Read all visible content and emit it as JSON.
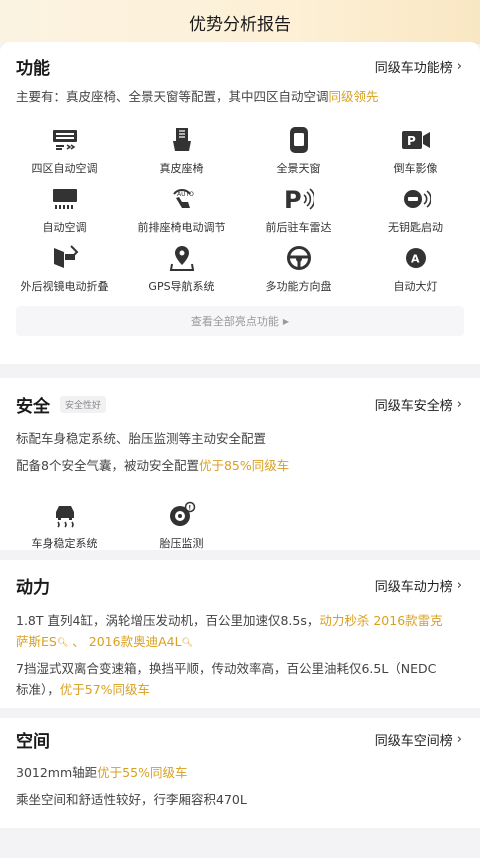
{
  "header": {
    "title": "优势分析报告"
  },
  "function_section": {
    "title": "功能",
    "rank_label": "同级车功能榜",
    "summary_prefix": "主要有：真皮座椅、全景天窗等配置，其中四区自动空调",
    "summary_highlight": "同级领先",
    "features": [
      {
        "label": "四区自动空调",
        "icon": "ac-vent-icon"
      },
      {
        "label": "真皮座椅",
        "icon": "seat-icon"
      },
      {
        "label": "全景天窗",
        "icon": "sunroof-icon"
      },
      {
        "label": "倒车影像",
        "icon": "reverse-camera-icon"
      },
      {
        "label": "自动空调",
        "icon": "auto-ac-icon"
      },
      {
        "label": "前排座椅电动调节",
        "icon": "power-seat-icon"
      },
      {
        "label": "前后驻车雷达",
        "icon": "parking-radar-icon"
      },
      {
        "label": "无钥匙启动",
        "icon": "keyless-start-icon"
      },
      {
        "label": "外后视镜电动折叠",
        "icon": "mirror-fold-icon"
      },
      {
        "label": "GPS导航系统",
        "icon": "gps-icon"
      },
      {
        "label": "多功能方向盘",
        "icon": "steering-wheel-icon"
      },
      {
        "label": "自动大灯",
        "icon": "auto-headlight-icon"
      }
    ],
    "more_label": "查看全部亮点功能"
  },
  "safety_section": {
    "title": "安全",
    "badge": "安全性好",
    "rank_label": "同级车安全榜",
    "line1": "标配车身稳定系统、胎压监测等主动安全配置",
    "line2_prefix": "配备8个安全气囊，被动安全配置",
    "line2_highlight": "优于85%同级车",
    "features": [
      {
        "label": "车身稳定系统",
        "icon": "stability-control-icon"
      },
      {
        "label": "胎压监测",
        "icon": "tire-pressure-icon"
      }
    ]
  },
  "power_section": {
    "title": "动力",
    "rank_label": "同级车动力榜",
    "line1_prefix": "1.8T 直列4缸，涡轮增压发动机，百公里加速仅8.5s，",
    "line1_highlight": "动力秒杀",
    "link1_a": "2016款雷克",
    "link1_b": "萨斯ES",
    "sep": "、",
    "link2": "2016款奥迪A4L",
    "line2_prefix": "7挡湿式双离合变速箱，换挡平顺，传动效率高，百公里油耗仅6.5L（NEDC",
    "line2_b": "标准），",
    "line2_highlight": "优于57%同级车"
  },
  "space_section": {
    "title": "空间",
    "rank_label": "同级车空间榜",
    "line1_prefix": "3012mm轴距",
    "line1_highlight": "优于55%同级车",
    "line2": "乘坐空间和舒适性较好，行李厢容积470L"
  },
  "colors": {
    "accent": "#d9a020",
    "header_bg": "#fdf0d6"
  }
}
